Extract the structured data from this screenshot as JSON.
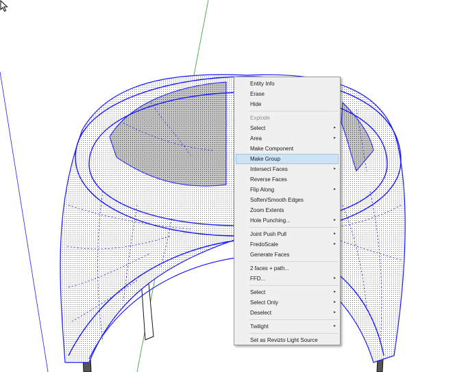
{
  "context_menu": {
    "groups": [
      [
        {
          "label": "Entity Info",
          "submenu": false
        },
        {
          "label": "Erase",
          "submenu": false
        },
        {
          "label": "Hide",
          "submenu": false
        }
      ],
      [
        {
          "label": "Explode",
          "submenu": false,
          "disabled": true
        },
        {
          "label": "Select",
          "submenu": true
        },
        {
          "label": "Area",
          "submenu": true
        },
        {
          "label": "Make Component",
          "submenu": false
        },
        {
          "label": "Make Group",
          "submenu": false,
          "highlighted": true
        },
        {
          "label": "Intersect Faces",
          "submenu": true
        },
        {
          "label": "Reverse Faces",
          "submenu": false
        },
        {
          "label": "Flip Along",
          "submenu": true
        },
        {
          "label": "Soften/Smooth Edges",
          "submenu": false
        },
        {
          "label": "Zoom Extents",
          "submenu": false
        },
        {
          "label": "Hole Punching...",
          "submenu": true
        }
      ],
      [
        {
          "label": "Joint Push Pull",
          "submenu": true
        },
        {
          "label": "FredoScale",
          "submenu": true
        },
        {
          "label": "Generate Faces",
          "submenu": false
        }
      ],
      [
        {
          "label": "2 faces + path...",
          "submenu": false
        },
        {
          "label": "FFD...",
          "submenu": true
        }
      ],
      [
        {
          "label": "Select",
          "submenu": true
        },
        {
          "label": "Select Only",
          "submenu": true
        },
        {
          "label": "Deselect",
          "submenu": true
        }
      ],
      [
        {
          "label": "Twilight",
          "submenu": true
        }
      ],
      [
        {
          "label": "Set as Revizto Light Source",
          "submenu": false
        }
      ]
    ]
  },
  "colors": {
    "model_edge": "#1a1aff",
    "menu_background": "#f0f0f0",
    "menu_highlight": "#cde4f7",
    "green_axis": "#2aa02a"
  },
  "icons": {
    "submenu_arrow": "▸",
    "cursor": "mouse-pointer-icon"
  }
}
